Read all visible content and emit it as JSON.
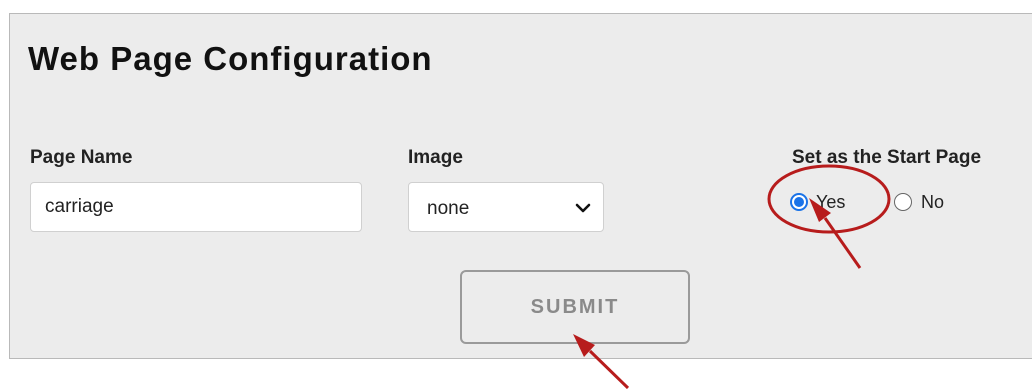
{
  "form": {
    "title": "Web Page Configuration",
    "page_name": {
      "label": "Page Name",
      "value": "carriage"
    },
    "image": {
      "label": "Image",
      "selected": "none"
    },
    "start_page": {
      "label": "Set as the Start Page",
      "options": [
        {
          "label": "Yes",
          "checked": true
        },
        {
          "label": "No",
          "checked": false
        }
      ]
    },
    "submit_label": "SUBMIT"
  },
  "annotations": {
    "color": "#b71c1c",
    "radio_color": "#1a73e8"
  }
}
